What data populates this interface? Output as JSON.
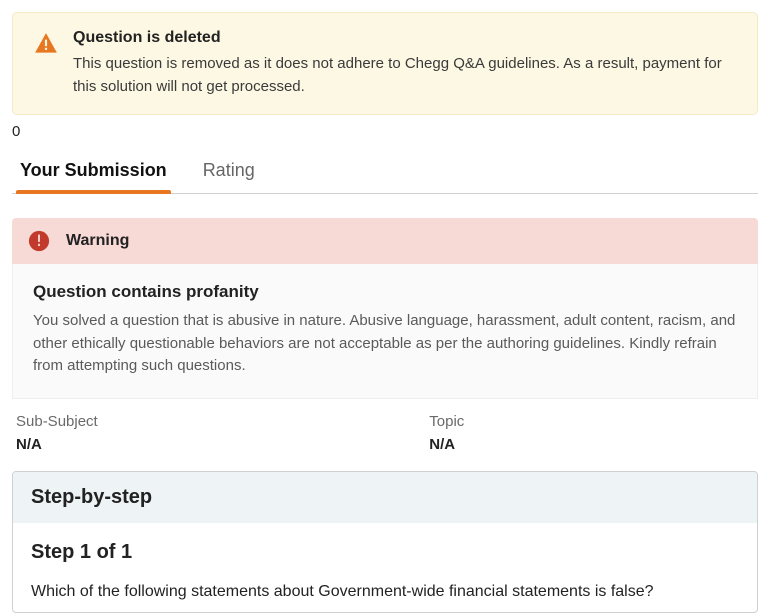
{
  "deleted_banner": {
    "title": "Question is deleted",
    "desc": "This question is removed as it does not adhere to Chegg Q&A guidelines. As a result, payment for this solution will not get processed."
  },
  "zero": "0",
  "tabs": {
    "submission": "Your Submission",
    "rating": "Rating"
  },
  "warning": {
    "label": "Warning",
    "title": "Question contains profanity",
    "desc": "You solved a question that is abusive in nature. Abusive language, harassment, adult content, racism, and other ethically questionable behaviors are not acceptable as per the authoring guidelines. Kindly refrain from attempting such questions."
  },
  "meta": {
    "sub_subject_label": "Sub-Subject",
    "sub_subject_value": "N/A",
    "topic_label": "Topic",
    "topic_value": "N/A"
  },
  "step": {
    "header": "Step-by-step",
    "title": "Step 1 of 1",
    "text": "Which of the following statements about Government-wide financial statements is false?"
  }
}
